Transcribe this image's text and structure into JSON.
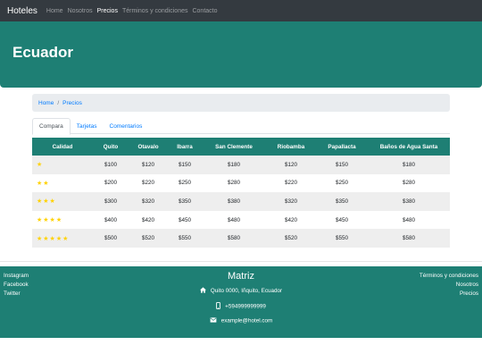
{
  "navbar": {
    "brand": "Hoteles",
    "links": [
      "Home",
      "Nosotros",
      "Precios",
      "Términos y condiciones",
      "Contacto"
    ],
    "active": "Precios"
  },
  "hero": {
    "title": "Ecuador"
  },
  "breadcrumb": [
    "Home",
    "Precios"
  ],
  "tabs": [
    "Compara",
    "Tarjetas",
    "Comentarios"
  ],
  "table": {
    "headers": [
      "Calidad",
      "Quito",
      "Otavalo",
      "Ibarra",
      "San Clemente",
      "Riobamba",
      "Papallacta",
      "Baños de Agua Santa"
    ],
    "rows": [
      {
        "stars": "★",
        "prices": [
          "$100",
          "$120",
          "$150",
          "$180",
          "$120",
          "$150",
          "$180"
        ]
      },
      {
        "stars": "★★",
        "prices": [
          "$200",
          "$220",
          "$250",
          "$280",
          "$220",
          "$250",
          "$280"
        ]
      },
      {
        "stars": "★★★",
        "prices": [
          "$300",
          "$320",
          "$350",
          "$380",
          "$320",
          "$350",
          "$380"
        ]
      },
      {
        "stars": "★★★★",
        "prices": [
          "$400",
          "$420",
          "$450",
          "$480",
          "$420",
          "$450",
          "$480"
        ]
      },
      {
        "stars": "★★★★★",
        "prices": [
          "$500",
          "$520",
          "$550",
          "$580",
          "$520",
          "$550",
          "$580"
        ]
      }
    ]
  },
  "footer": {
    "social": [
      "Instagram",
      "Facebook",
      "Twitter"
    ],
    "title": "Matriz",
    "address": "Quito 0000, Iñquito, Ecuador",
    "phone": "+594999999999",
    "email": "example@hotel.com",
    "links": [
      "Términos y condiciones",
      "Nosotros",
      "Precios"
    ]
  },
  "icons": {
    "address": "home-icon",
    "phone": "mobile-phone-icon",
    "email": "envelope-icon"
  },
  "colors": {
    "teal": "#1e7f74",
    "navbar": "#343a40",
    "link": "#007bff",
    "star": "#ffd200"
  }
}
